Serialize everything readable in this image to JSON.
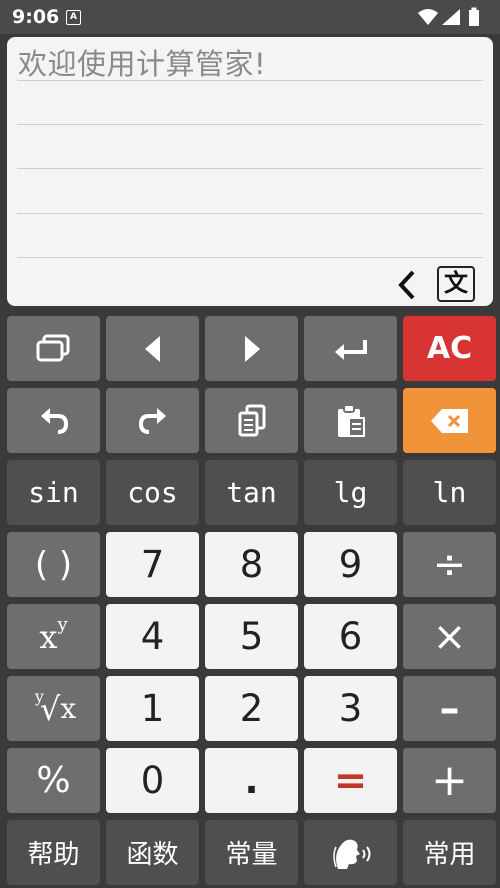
{
  "status_bar": {
    "time": "9:06",
    "notification_icon": "A"
  },
  "display": {
    "message": "欢迎使用计算管家!",
    "mode_button": "文"
  },
  "keys": {
    "row1": {
      "ac": "AC"
    },
    "row3": {
      "sin": "sin",
      "cos": "cos",
      "tan": "tan",
      "lg": "lg",
      "ln": "ln"
    },
    "row4": {
      "paren": "( )",
      "seven": "7",
      "eight": "8",
      "nine": "9",
      "divide": "÷"
    },
    "row5": {
      "power_base": "x",
      "power_exp": "y",
      "four": "4",
      "five": "5",
      "six": "6",
      "multiply": "×"
    },
    "row6": {
      "root_index": "y",
      "root_radicand": "x",
      "one": "1",
      "two": "2",
      "three": "3",
      "minus": "–"
    },
    "row7": {
      "percent": "%",
      "zero": "0",
      "dot": ".",
      "equals": "=",
      "plus": "+"
    },
    "row8": {
      "help": "帮助",
      "functions": "函数",
      "constants": "常量",
      "common": "常用"
    }
  },
  "colors": {
    "equals": "#c0392b",
    "ac_key": "#d83434",
    "backspace_key": "#f19339"
  },
  "icons": [
    "window-icon",
    "triangle-left-icon",
    "triangle-right-icon",
    "return-icon",
    "undo-icon",
    "redo-icon",
    "copy-icon",
    "paste-icon",
    "backspace-icon",
    "voice-icon",
    "chevron-left-icon"
  ]
}
